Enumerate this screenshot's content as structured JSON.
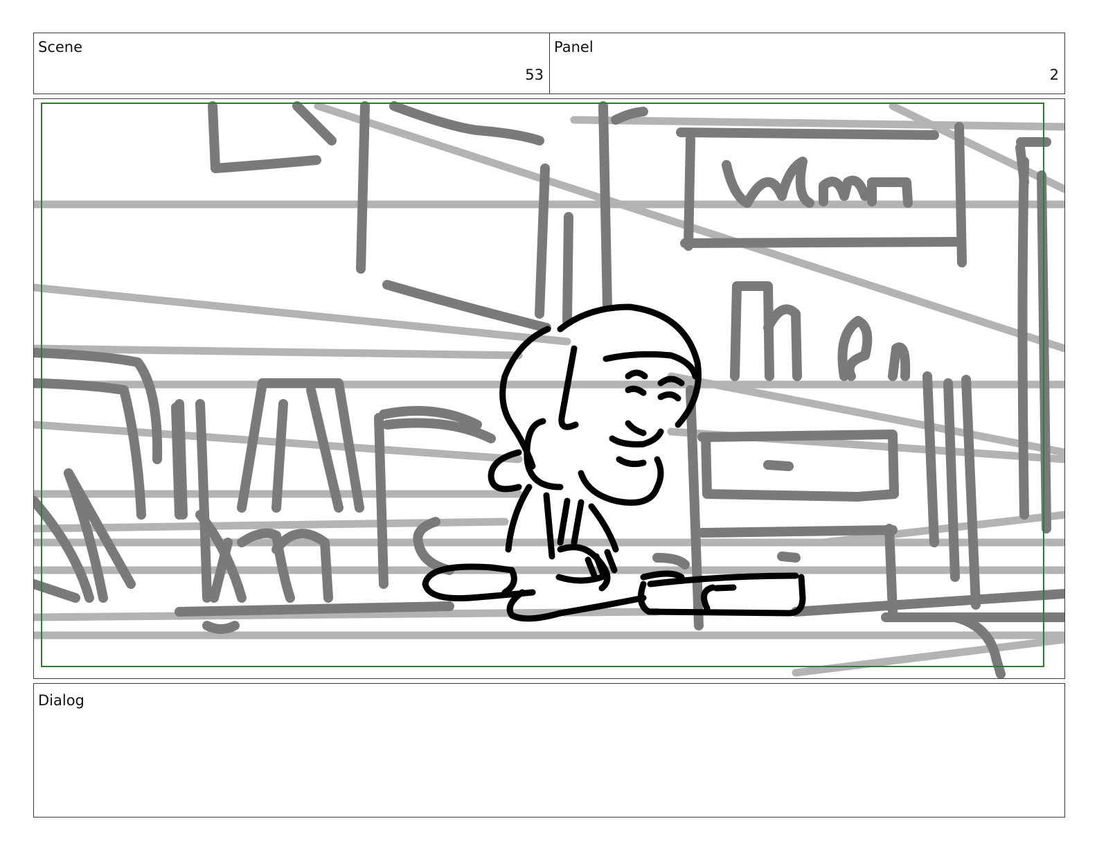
{
  "header": {
    "scene_label": "Scene",
    "scene_number": "53",
    "panel_label": "Panel",
    "panel_number": "2"
  },
  "frame": {
    "image_name": "storyboard-sketch",
    "safe_area_color": "#2e7d32",
    "background_stroke_color": "#7a7a7a",
    "horizon_line_color": "#b3b3b3",
    "character_stroke_color": "#000000"
  },
  "dialog": {
    "label": "Dialog",
    "text": ""
  }
}
